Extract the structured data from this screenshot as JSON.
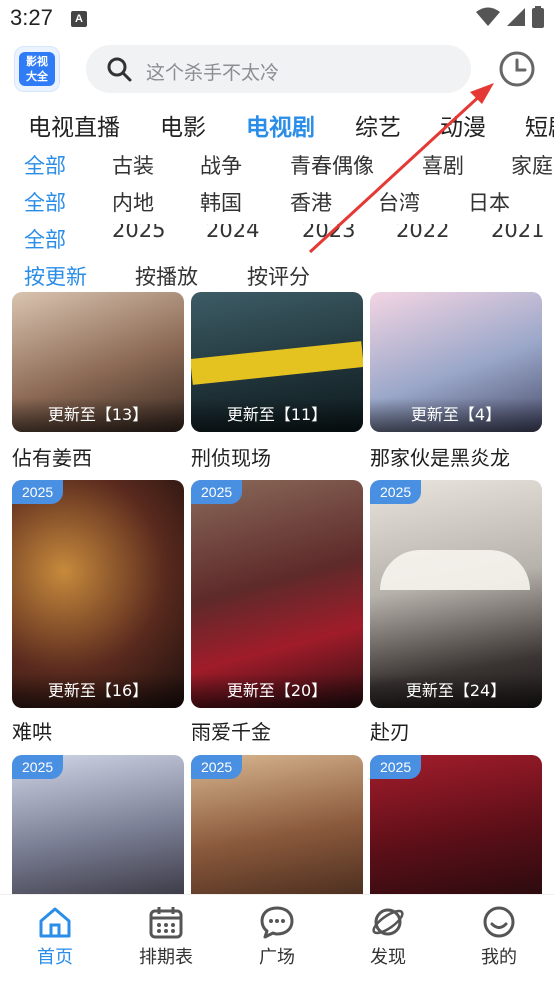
{
  "status_bar": {
    "time": "3:27",
    "notif": "A"
  },
  "header": {
    "logo_text_1": "影视",
    "logo_text_2": "大全",
    "search_placeholder": "这个杀手不太冷"
  },
  "tabs": [
    {
      "label": "电视直播",
      "active": false
    },
    {
      "label": "电影",
      "active": false
    },
    {
      "label": "电视剧",
      "active": true
    },
    {
      "label": "综艺",
      "active": false
    },
    {
      "label": "动漫",
      "active": false
    },
    {
      "label": "短剧",
      "active": false
    }
  ],
  "filters": {
    "genre": [
      "全部",
      "古装",
      "战争",
      "青春偶像",
      "喜剧",
      "家庭"
    ],
    "region": [
      "全部",
      "内地",
      "韩国",
      "香港",
      "台湾",
      "日本"
    ],
    "year": [
      "全部",
      "2025",
      "2024",
      "2023",
      "2022",
      "2021"
    ],
    "sort": [
      "按更新",
      "按播放",
      "按评分"
    ]
  },
  "cards": [
    {
      "title": "佔有姜西",
      "update": "更新至【13】",
      "year": ""
    },
    {
      "title": "刑侦现场",
      "update": "更新至【11】",
      "year": ""
    },
    {
      "title": "那家伙是黑炎龙",
      "update": "更新至【4】",
      "year": ""
    },
    {
      "title": "难哄",
      "update": "更新至【16】",
      "year": "2025"
    },
    {
      "title": "雨爱千金",
      "update": "更新至【20】",
      "year": "2025"
    },
    {
      "title": "赴刃",
      "update": "更新至【24】",
      "year": "2025"
    },
    {
      "title": "",
      "update": "",
      "year": "2025"
    },
    {
      "title": "",
      "update": "",
      "year": "2025"
    },
    {
      "title": "",
      "update": "",
      "year": "2025"
    }
  ],
  "bottom_nav": [
    {
      "label": "首页",
      "icon": "home-icon",
      "active": true
    },
    {
      "label": "排期表",
      "icon": "calendar-icon",
      "active": false
    },
    {
      "label": "广场",
      "icon": "chat-icon",
      "active": false
    },
    {
      "label": "发现",
      "icon": "planet-icon",
      "active": false
    },
    {
      "label": "我的",
      "icon": "smile-icon",
      "active": false
    }
  ],
  "colors": {
    "accent": "#2a8de8",
    "badge": "#4a90e2",
    "annotation": "#e53935"
  }
}
